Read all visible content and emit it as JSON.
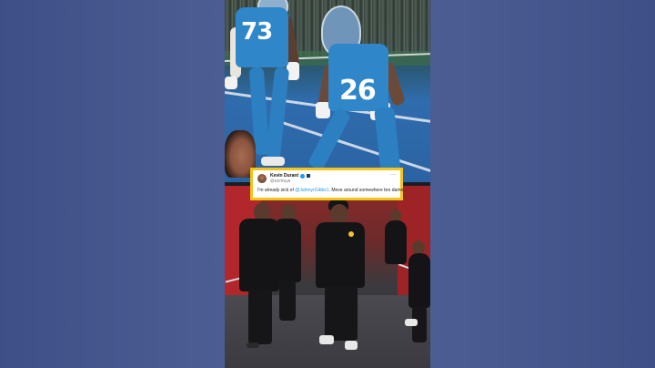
{
  "tweet": {
    "author_name": "Kevin Durant",
    "handle": "@KDTrey5",
    "text_before": "I'm already sick of ",
    "mention": "@JahmyrGibbs1",
    "text_after": ". Move around somewhere bro damn.",
    "more_label": "···"
  },
  "top_scene": {
    "left_player_number": "73",
    "right_player_number": "26"
  },
  "colors": {
    "tweet_border": "#f3c41b",
    "mention_blue": "#1d9bf0",
    "lions_blue": "#2f86c9",
    "tunnel_red": "#b2272b"
  }
}
